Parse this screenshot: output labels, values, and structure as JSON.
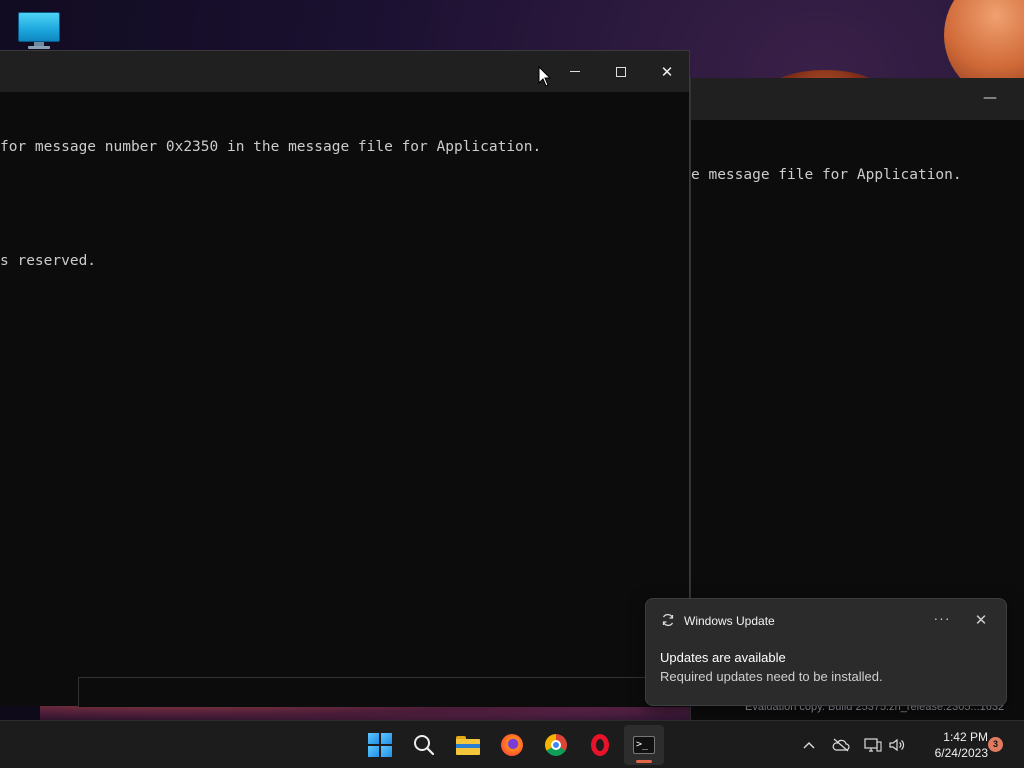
{
  "desktop": {
    "icon_name": "this-pc-icon",
    "watermark": "Evaluation copy. Build 25375.zn_release.2305...1632"
  },
  "terminal_back": {
    "minimize_glyph": "—",
    "lines": [
      "e message file for Application."
    ]
  },
  "terminal_front": {
    "lines": [
      "for message number 0x2350 in the message file for Application.",
      "",
      "s reserved."
    ],
    "controls": {
      "minimize": "Minimize",
      "maximize": "Maximize",
      "close": "Close"
    },
    "close_glyph": "✕"
  },
  "notification": {
    "app": "Windows Update",
    "more_glyph": "···",
    "close_glyph": "✕",
    "title": "Updates are available",
    "body": "Required updates need to be installed."
  },
  "taskbar": {
    "apps": [
      {
        "name": "Start",
        "icon": "windows-icon"
      },
      {
        "name": "Search",
        "icon": "search-icon"
      },
      {
        "name": "File Explorer",
        "icon": "folder-icon"
      },
      {
        "name": "Firefox",
        "icon": "firefox-icon"
      },
      {
        "name": "Chrome",
        "icon": "chrome-icon"
      },
      {
        "name": "Opera",
        "icon": "opera-icon"
      },
      {
        "name": "Terminal",
        "icon": "terminal-icon",
        "active": true
      }
    ],
    "terminal_prompt": ">_",
    "tray": {
      "chevron": "^",
      "time": "1:42 PM",
      "date": "6/24/2023",
      "notification_count": "3"
    }
  },
  "colors": {
    "terminal_bg": "#0c0c0c",
    "titlebar_bg": "#202020",
    "taskbar_bg": "#1c1c1c",
    "accent_indicator": "#e0664a"
  }
}
